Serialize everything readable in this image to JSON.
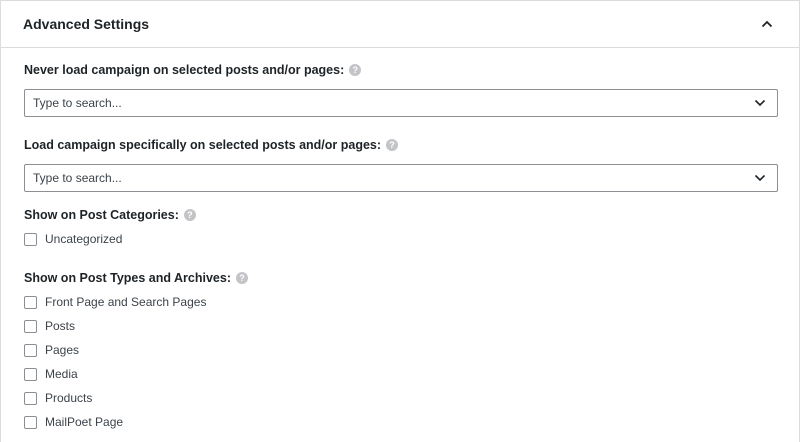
{
  "panel": {
    "title": "Advanced Settings",
    "toggle_icon": "chevron-up-icon"
  },
  "never_load": {
    "label": "Never load campaign on selected posts and/or pages:",
    "placeholder": "Type to search..."
  },
  "load_specific": {
    "label": "Load campaign specifically on selected posts and/or pages:",
    "placeholder": "Type to search..."
  },
  "post_categories": {
    "label": "Show on Post Categories:",
    "options": [
      "Uncategorized"
    ]
  },
  "post_types": {
    "label": "Show on Post Types and Archives:",
    "options": [
      "Front Page and Search Pages",
      "Posts",
      "Pages",
      "Media",
      "Products",
      "MailPoet Page"
    ]
  },
  "help_glyph": "?",
  "colors": {
    "border": "#dcdcde",
    "input_border": "#8c8f94",
    "help_bg": "#c3c4c7",
    "text": "#1d2327"
  }
}
